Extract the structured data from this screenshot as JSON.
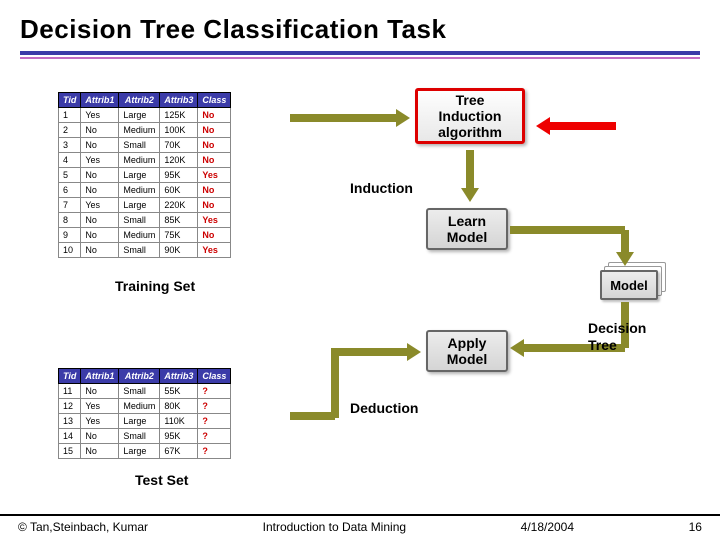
{
  "title": "Decision Tree Classification Task",
  "training_table": {
    "headers": [
      "Tid",
      "Attrib1",
      "Attrib2",
      "Attrib3",
      "Class"
    ],
    "rows": [
      [
        "1",
        "Yes",
        "Large",
        "125K",
        "No"
      ],
      [
        "2",
        "No",
        "Medium",
        "100K",
        "No"
      ],
      [
        "3",
        "No",
        "Small",
        "70K",
        "No"
      ],
      [
        "4",
        "Yes",
        "Medium",
        "120K",
        "No"
      ],
      [
        "5",
        "No",
        "Large",
        "95K",
        "Yes"
      ],
      [
        "6",
        "No",
        "Medium",
        "60K",
        "No"
      ],
      [
        "7",
        "Yes",
        "Large",
        "220K",
        "No"
      ],
      [
        "8",
        "No",
        "Small",
        "85K",
        "Yes"
      ],
      [
        "9",
        "No",
        "Medium",
        "75K",
        "No"
      ],
      [
        "10",
        "No",
        "Small",
        "90K",
        "Yes"
      ]
    ],
    "label": "Training Set"
  },
  "test_table": {
    "headers": [
      "Tid",
      "Attrib1",
      "Attrib2",
      "Attrib3",
      "Class"
    ],
    "rows": [
      [
        "11",
        "No",
        "Small",
        "55K",
        "?"
      ],
      [
        "12",
        "Yes",
        "Medium",
        "80K",
        "?"
      ],
      [
        "13",
        "Yes",
        "Large",
        "110K",
        "?"
      ],
      [
        "14",
        "No",
        "Small",
        "95K",
        "?"
      ],
      [
        "15",
        "No",
        "Large",
        "67K",
        "?"
      ]
    ],
    "label": "Test Set"
  },
  "flow": {
    "tree_induction": "Tree\nInduction\nalgorithm",
    "learn_model": "Learn\nModel",
    "apply_model": "Apply\nModel",
    "model": "Model",
    "induction": "Induction",
    "deduction": "Deduction"
  },
  "annotation": "Decision\nTree",
  "footer": {
    "left": "© Tan,Steinbach, Kumar",
    "center": "Introduction to Data Mining",
    "date": "4/18/2004",
    "page": "16"
  }
}
